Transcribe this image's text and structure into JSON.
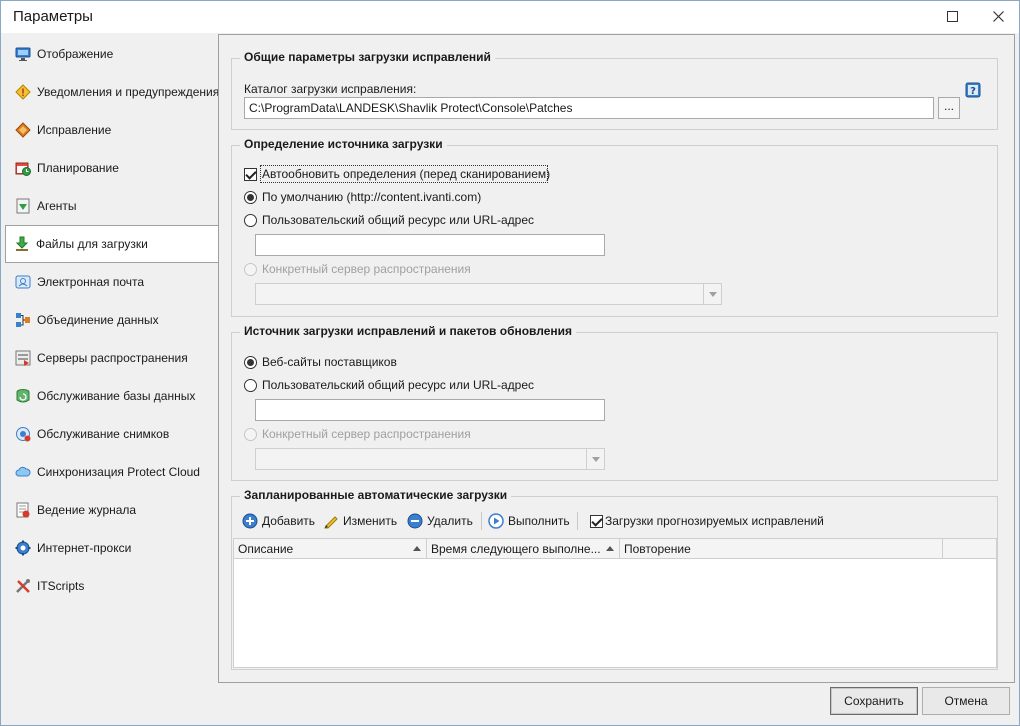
{
  "window": {
    "title": "Параметры"
  },
  "sidebar": {
    "items": [
      {
        "label": "Отображение",
        "icon": "monitor-icon"
      },
      {
        "label": "Уведомления и предупреждения",
        "icon": "warning-icon"
      },
      {
        "label": "Исправление",
        "icon": "patch-diamond-icon"
      },
      {
        "label": "Планирование",
        "icon": "schedule-icon"
      },
      {
        "label": "Агенты",
        "icon": "agent-icon"
      },
      {
        "label": "Файлы для загрузки",
        "icon": "download-icon"
      },
      {
        "label": "Электронная почта",
        "icon": "email-icon"
      },
      {
        "label": "Объединение данных",
        "icon": "data-merge-icon"
      },
      {
        "label": "Серверы распространения",
        "icon": "server-icon"
      },
      {
        "label": "Обслуживание базы данных",
        "icon": "database-maintenance-icon"
      },
      {
        "label": "Обслуживание снимков",
        "icon": "snapshot-icon"
      },
      {
        "label": "Синхронизация Protect Cloud",
        "icon": "cloud-icon"
      },
      {
        "label": "Ведение журнала",
        "icon": "log-icon"
      },
      {
        "label": "Интернет-прокси",
        "icon": "proxy-gear-icon"
      },
      {
        "label": "ITScripts",
        "icon": "tools-icon"
      }
    ],
    "active_index": 5
  },
  "general": {
    "title": "Общие параметры загрузки исправлений",
    "folder_label": "Каталог загрузки исправления:",
    "folder_value": "C:\\ProgramData\\LANDESK\\Shavlik Protect\\Console\\Patches",
    "browse_label": "..."
  },
  "definitions": {
    "title": "Определение источника загрузки",
    "auto_update_label": "Автообновить определения (перед сканированием)",
    "auto_update_checked": true,
    "default_label": "По умолчанию (http://content.ivanti.com)",
    "custom_label": "Пользовательский общий ресурс или URL-адрес",
    "custom_value": "",
    "server_label": "Конкретный сервер распространения",
    "server_value": ""
  },
  "patch_source": {
    "title": "Источник загрузки исправлений и пакетов обновления",
    "vendor_label": "Веб-сайты поставщиков",
    "custom_label": "Пользовательский общий ресурс или URL-адрес",
    "custom_value": "",
    "server_label": "Конкретный сервер распространения",
    "server_value": ""
  },
  "scheduled": {
    "title": "Запланированные автоматические загрузки",
    "toolbar": {
      "add": "Добавить",
      "edit": "Изменить",
      "delete": "Удалить",
      "run": "Выполнить",
      "predictive_label": "Загрузки прогнозируемых исправлений",
      "predictive_checked": true
    },
    "columns": [
      "Описание",
      "Время следующего выполне...",
      "Повторение"
    ],
    "rows": []
  },
  "footer": {
    "save": "Сохранить",
    "cancel": "Отмена"
  },
  "colors": {
    "window_bg": "#f0f0f0",
    "accent_blue": "#1e6fc4",
    "border": "#a0a0a0"
  }
}
